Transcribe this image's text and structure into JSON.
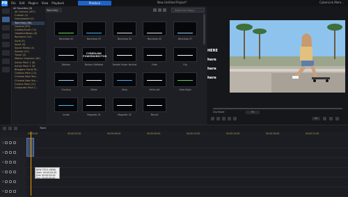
{
  "titlebar": {
    "logo": "PD",
    "menus": [
      "File",
      "Edit",
      "Plugins",
      "View",
      "Playback"
    ],
    "produce": "Produce",
    "project": "New Untitled Project*",
    "account": "CyberLink Mem..."
  },
  "library": {
    "sort_label": "Text Only",
    "search_placeholder": "Search the library",
    "tiles": [
      {
        "label": "Backdrop 02",
        "text": "",
        "accent": "#5de04a"
      },
      {
        "label": "Backdrop 03",
        "text": "",
        "accent": "#49b6ff"
      },
      {
        "label": "Backdrop 04",
        "text": "",
        "accent": "#e0e0e0"
      },
      {
        "label": "Backdrop 05",
        "text": "",
        "accent": "#e0e0e0"
      },
      {
        "label": "Backdrop 07",
        "text": "",
        "accent": "#9fd3ff"
      },
      {
        "label": "Balloon",
        "text": "",
        "accent": "#cfe8ff"
      },
      {
        "label": "Balloon Deflated",
        "text": "CYBERLINK POWERDIRECTOR",
        "accent": "#ffffff"
      },
      {
        "label": "Double Vision Vertical",
        "text": "",
        "accent": "#ffffff"
      },
      {
        "label": "Fade",
        "text": "",
        "accent": "#ffffff"
      },
      {
        "label": "Flip",
        "text": "",
        "accent": "#ffffff"
      },
      {
        "label": "Flocking",
        "text": "",
        "accent": "#9fd3ff"
      },
      {
        "label": "Glitter",
        "text": "",
        "accent": "#ffffff"
      },
      {
        "label": "Glow",
        "text": "",
        "accent": "#49b6ff"
      },
      {
        "label": "Hello Left",
        "text": "",
        "accent": "#ffffff"
      },
      {
        "label": "Hello Right",
        "text": "",
        "accent": "#5de04a"
      },
      {
        "label": "Inside",
        "text": "",
        "accent": "#49b6ff"
      },
      {
        "label": "Magnetic 01",
        "text": "",
        "accent": "#ffffff"
      },
      {
        "label": "Magnetic 02",
        "text": "",
        "accent": "#ffffff"
      },
      {
        "label": "Marvel",
        "text": "",
        "accent": "#ffffff"
      }
    ]
  },
  "categories": {
    "header": "All Favorites (6)",
    "items": [
      "All Content (407)",
      "Custom (1)",
      "Downloaded (0)",
      "Text Only (30)",
      "General (59)",
      "Credits/Scroll (72)",
      "Headline/News (8)",
      "Romance (10)",
      "Style (5)",
      "Sport (4)",
      "Social Media (4)",
      "Spooky (21)",
      "Travel (2)",
      "Motion Graphics (40)",
      "Action Pack 1 (6)",
      "Action Pack 2 (5)",
      "Bloggers Social M...",
      "Cartoon Pack (12)",
      "Chinese New Yea...",
      "Chinese New Yea...",
      "Comics Pack (11)",
      "Corporate Pack 1..."
    ],
    "selected_index": 3
  },
  "preview": {
    "overlay_lines": [
      "HERE",
      "here",
      "here",
      "here"
    ],
    "zoom": "Fit",
    "quality": "1/4"
  },
  "timeline": {
    "label": "Track",
    "ruler": [
      "00:00:00",
      "00:00:03:00",
      "00:00:06:00",
      "00:00:09:00",
      "00:00:12:00",
      "00:00:15:00",
      "00:00:18:00",
      "00:00:21:00"
    ],
    "tracks": [
      "1",
      "1",
      "2",
      "2",
      "3",
      "3"
    ],
    "tooltip": [
      "NEW TITLE (NEW)",
      "Start: 00:00:00:00",
      "End: 00:00:05:00",
      "Dur: 00:00:05:00"
    ]
  }
}
